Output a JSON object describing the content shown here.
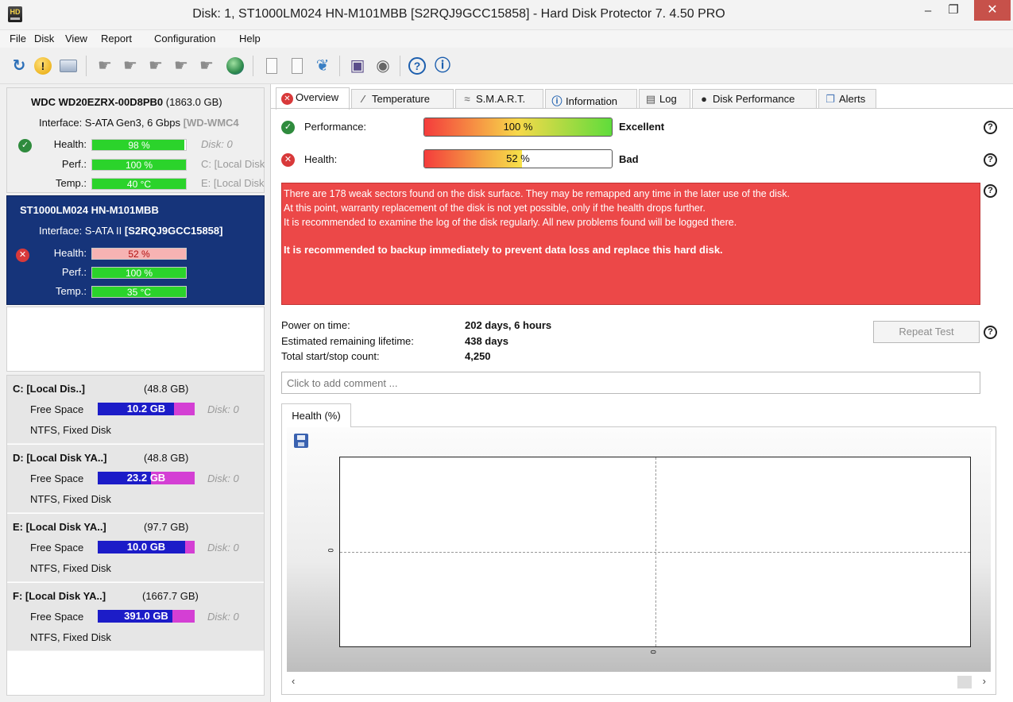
{
  "window": {
    "title": "Disk: 1, ST1000LM024 HN-M101MBB [S2RQJ9GCC15858]  -  Hard Disk Protector 7. 4.50 PRO",
    "app_icon_text": "HD",
    "minimize": "–",
    "maximize": "❐",
    "close": "✕"
  },
  "menu": [
    "File",
    "Disk",
    "View",
    "Report",
    "Configuration",
    "Help"
  ],
  "disks": [
    {
      "model": "WDC WD20EZRX-00D8PB0",
      "size": "(1863.0 GB)",
      "interface_label": "Interface: S-ATA Gen3, 6 Gbps ",
      "serial": "[WD-WMC4",
      "health_label": "Health:",
      "health": "98 %",
      "health_frac": 0.98,
      "perf_label": "Perf.:",
      "perf": "100 %",
      "perf_frac": 1.0,
      "temp_label": "Temp.:",
      "temp": "40 °C",
      "temp_frac": 1.0,
      "hints": [
        "Disk: 0",
        "C: [Local Disk",
        "E: [Local Disk"
      ],
      "status": "ok"
    },
    {
      "model": "ST1000LM024 HN-M101MBB",
      "size": "",
      "interface_label": "Interface: S-ATA II ",
      "serial": "[S2RQJ9GCC15858]",
      "health_label": "Health:",
      "health": "52 %",
      "health_frac": 0.52,
      "perf_label": "Perf.:",
      "perf": "100 %",
      "perf_frac": 1.0,
      "temp_label": "Temp.:",
      "temp": "35 °C",
      "temp_frac": 1.0,
      "hints": [],
      "status": "bad"
    }
  ],
  "volumes": [
    {
      "name": "C: [Local Dis..]",
      "size": "(48.8 GB)",
      "free_label": "Free Space",
      "free": "10.2 GB",
      "free_frac": 0.79,
      "disk": "Disk: 0",
      "type": "NTFS, Fixed Disk"
    },
    {
      "name": "D: [Local Disk YA..]",
      "size": "(48.8 GB)",
      "free_label": "Free Space",
      "free": "23.2 GB",
      "free_frac": 0.55,
      "disk": "Disk: 0",
      "type": "NTFS, Fixed Disk"
    },
    {
      "name": "E: [Local Disk YA..]",
      "size": "(97.7 GB)",
      "free_label": "Free Space",
      "free": "10.0 GB",
      "free_frac": 0.9,
      "disk": "Disk: 0",
      "type": "NTFS, Fixed Disk"
    },
    {
      "name": "F: [Local Disk YA..]",
      "size": "(1667.7 GB)",
      "free_label": "Free Space",
      "free": "391.0 GB",
      "free_frac": 0.77,
      "disk": "Disk: 0",
      "type": "NTFS, Fixed Disk"
    }
  ],
  "tabs": [
    {
      "label": "Overview",
      "icon": "x-circle-icon"
    },
    {
      "label": "Temperature",
      "icon": "thermometer-icon"
    },
    {
      "label": "S.M.A.R.T.",
      "icon": "smart-icon"
    },
    {
      "label": "Information",
      "icon": "info-icon"
    },
    {
      "label": "Log",
      "icon": "log-icon"
    },
    {
      "label": "Disk Performance",
      "icon": "performance-icon"
    },
    {
      "label": "Alerts",
      "icon": "alerts-icon"
    }
  ],
  "overview": {
    "performance_label": "Performance:",
    "performance_value": "100 %",
    "performance_frac": 1.0,
    "performance_verdict": "Excellent",
    "health_label": "Health:",
    "health_value": "52 %",
    "health_frac": 0.52,
    "health_verdict": "Bad",
    "alert_lines": [
      "There are 178 weak sectors found on the disk surface. They may be remapped any time in the later use of the disk.",
      "At this point, warranty replacement of the disk is not yet possible, only if the health drops further.",
      "It is recommended to examine the log of the disk regularly. All new problems found will be logged there."
    ],
    "alert_strong": "It is recommended to backup immediately to prevent data loss and replace this hard disk.",
    "power_on_label": "Power on time:",
    "power_on_value": "202 days, 6 hours",
    "lifetime_label": "Estimated remaining lifetime:",
    "lifetime_value": "438 days",
    "startstop_label": "Total start/stop count:",
    "startstop_value": "4,250",
    "repeat_test": "Repeat Test",
    "comment_placeholder": "Click to add comment ...",
    "chart_tab": "Health (%)"
  },
  "chart_data": {
    "type": "line",
    "title": "",
    "xlabel": "",
    "ylabel": "",
    "x_tick_labels": [
      "0"
    ],
    "y_tick_labels": [
      "0"
    ],
    "series": [],
    "grid": true
  },
  "colors": {
    "selected_disk": "#16347a",
    "alert_bg": "#ec4848",
    "good_bar": "#2bd32b",
    "bad_bar": "#f6b3b3",
    "free_space": "#1c1cc8",
    "used_space": "#d43fd4"
  }
}
